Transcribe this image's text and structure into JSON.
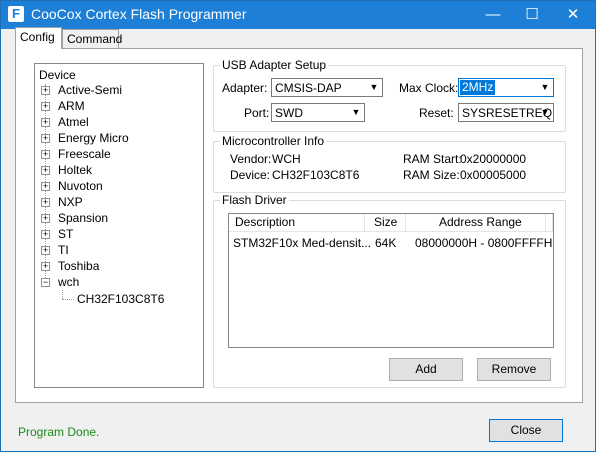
{
  "window": {
    "title": "CooCox Cortex Flash Programmer",
    "icon_letter": "F"
  },
  "titlebar_buttons": {
    "minimize": "—",
    "maximize": "☐",
    "close": "✕"
  },
  "tabs": [
    {
      "label": "Config",
      "selected": true
    },
    {
      "label": "Command",
      "selected": false
    }
  ],
  "tree": {
    "root": "Device",
    "expander_collapsed": "+",
    "expander_expanded": "−",
    "items": [
      {
        "label": "Active-Semi"
      },
      {
        "label": "ARM"
      },
      {
        "label": "Atmel"
      },
      {
        "label": "Energy Micro"
      },
      {
        "label": "Freescale"
      },
      {
        "label": "Holtek"
      },
      {
        "label": "Nuvoton"
      },
      {
        "label": "NXP"
      },
      {
        "label": "Spansion"
      },
      {
        "label": "ST"
      },
      {
        "label": "TI"
      },
      {
        "label": "Toshiba"
      },
      {
        "label": "wch"
      }
    ],
    "selected_child": "CH32F103C8T6"
  },
  "usb_adapter": {
    "title": "USB Adapter Setup",
    "adapter_label": "Adapter:",
    "adapter_value": "CMSIS-DAP",
    "port_label": "Port:",
    "port_value": "SWD",
    "max_clock_label": "Max Clock:",
    "max_clock_value": "2MHz",
    "reset_label": "Reset:",
    "reset_value": "SYSRESETREQ",
    "dropdown_arrow": "▼"
  },
  "mcu_info": {
    "title": "Microcontroller Info",
    "vendor_label": "Vendor:",
    "vendor_value": "WCH",
    "device_label": "Device:",
    "device_value": "CH32F103C8T6",
    "ram_start_label": "RAM Start:",
    "ram_start_value": "0x20000000",
    "ram_size_label": "RAM Size:",
    "ram_size_value": "0x00005000"
  },
  "flash_driver": {
    "title": "Flash Driver",
    "columns": [
      "Description",
      "Size",
      "Address Range"
    ],
    "rows": [
      {
        "description": "STM32F10x Med-densit...",
        "size": "64K",
        "address_range": "08000000H - 0800FFFFH"
      }
    ],
    "add_label": "Add",
    "remove_label": "Remove"
  },
  "status": {
    "text": "Program Done.",
    "color": "#1a8a1a"
  },
  "close_label": "Close"
}
